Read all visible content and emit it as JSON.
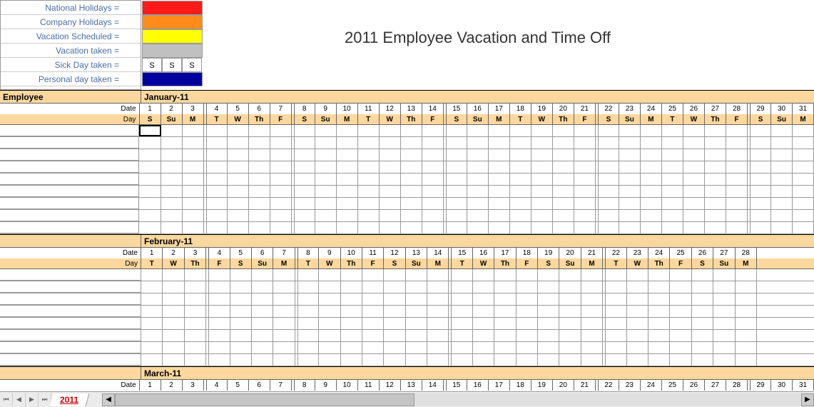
{
  "title": "2011 Employee Vacation and Time Off",
  "legend": {
    "items": [
      {
        "label": "National Holidays =",
        "color": "#ff1a1a"
      },
      {
        "label": "Company Holidays =",
        "color": "#ff8c1a"
      },
      {
        "label": "Vacation Scheduled =",
        "color": "#ffff00"
      },
      {
        "label": "Vacation taken =",
        "color": "#c0c0c0"
      },
      {
        "label": "Sick Day taken =",
        "cells": [
          "S",
          "S",
          "S"
        ]
      },
      {
        "label": "Personal day taken =",
        "color": "#0000a0"
      }
    ]
  },
  "header": {
    "employee_label": "Employee",
    "date_label": "Date",
    "day_label": "Day"
  },
  "months": [
    {
      "name": "January-11",
      "dates": [
        1,
        2,
        3,
        4,
        5,
        6,
        7,
        8,
        9,
        10,
        11,
        12,
        13,
        14,
        15,
        16,
        17,
        18,
        19,
        20,
        21,
        22,
        23,
        24,
        25,
        26,
        27,
        28,
        29,
        30,
        31
      ],
      "days": [
        "S",
        "Su",
        "M",
        "T",
        "W",
        "Th",
        "F",
        "S",
        "Su",
        "M",
        "T",
        "W",
        "Th",
        "F",
        "S",
        "Su",
        "M",
        "T",
        "W",
        "Th",
        "F",
        "S",
        "Su",
        "M",
        "T",
        "W",
        "Th",
        "F",
        "S",
        "Su",
        "M"
      ],
      "data_rows": 9,
      "show_employee_label": true
    },
    {
      "name": "February-11",
      "dates": [
        1,
        2,
        3,
        4,
        5,
        6,
        7,
        8,
        9,
        10,
        11,
        12,
        13,
        14,
        15,
        16,
        17,
        18,
        19,
        20,
        21,
        22,
        23,
        24,
        25,
        26,
        27,
        28
      ],
      "days": [
        "T",
        "W",
        "Th",
        "F",
        "S",
        "Su",
        "M",
        "T",
        "W",
        "Th",
        "F",
        "S",
        "Su",
        "M",
        "T",
        "W",
        "Th",
        "F",
        "S",
        "Su",
        "M",
        "T",
        "W",
        "Th",
        "F",
        "S",
        "Su",
        "M"
      ],
      "data_rows": 8,
      "show_employee_label": false
    },
    {
      "name": "March-11",
      "dates": [
        1,
        2,
        3,
        4,
        5,
        6,
        7,
        8,
        9,
        10,
        11,
        12,
        13,
        14,
        15,
        16,
        17,
        18,
        19,
        20,
        21,
        22,
        23,
        24,
        25,
        26,
        27,
        28,
        29,
        30,
        31
      ],
      "days": [],
      "data_rows": 0,
      "show_employee_label": false,
      "partial": true
    }
  ],
  "sheet": {
    "active_tab": "2011"
  },
  "active_cell": {
    "month": 0,
    "row": 0,
    "col": 0
  }
}
